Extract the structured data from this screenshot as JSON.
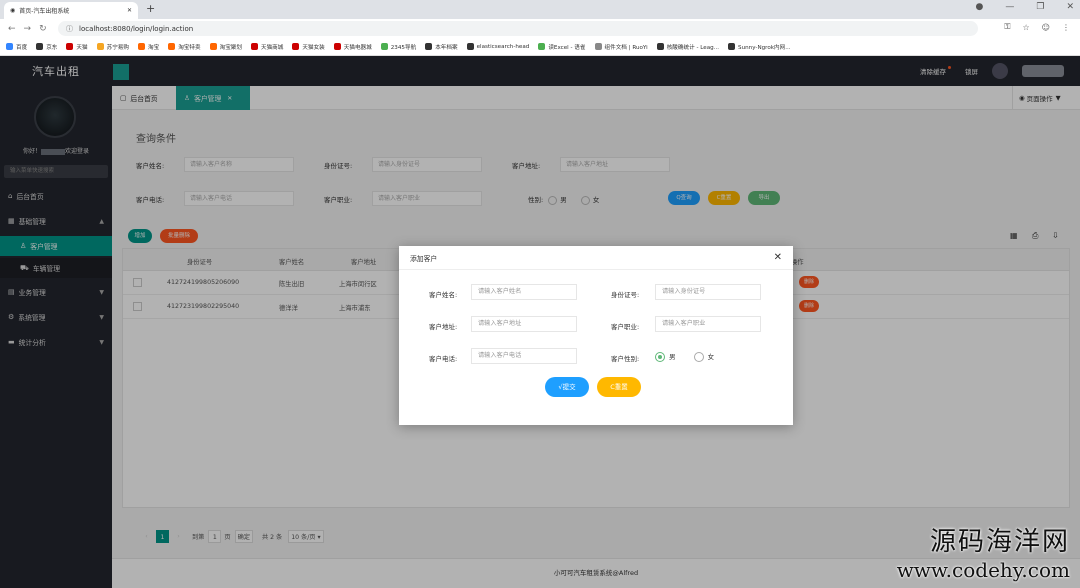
{
  "browser": {
    "tab_title": "首页-汽车出租系统",
    "url": "localhost:8080/login/login.action",
    "bookmarks": [
      {
        "label": "百度",
        "color": "#3385ff"
      },
      {
        "label": "京东",
        "color": "#333"
      },
      {
        "label": "天猫",
        "color": "#c00"
      },
      {
        "label": "苏宁易购",
        "color": "#f5a623"
      },
      {
        "label": "淘宝",
        "color": "#ff6600"
      },
      {
        "label": "淘宝特卖",
        "color": "#ff6600"
      },
      {
        "label": "淘宝聚划",
        "color": "#ff6600"
      },
      {
        "label": "天猫商城",
        "color": "#c00"
      },
      {
        "label": "天猫女装",
        "color": "#c00"
      },
      {
        "label": "天猫电器城",
        "color": "#c00"
      },
      {
        "label": "2345导航",
        "color": "#4caf50"
      },
      {
        "label": "本年档案",
        "color": "#333"
      },
      {
        "label": "elasticsearch-head",
        "color": "#333"
      },
      {
        "label": "读Excel - 语雀",
        "color": "#4caf50"
      },
      {
        "label": "组件文档 | RuoYi",
        "color": "#888"
      },
      {
        "label": "核酸确统计 - Leag...",
        "color": "#333"
      },
      {
        "label": "Sunny-Ngrok内网...",
        "color": "#333"
      }
    ]
  },
  "app": {
    "logo": "汽车出租",
    "clear_cache": "清除缓存",
    "lock_screen": "锁屏"
  },
  "sidebar": {
    "greeting_prefix": "你好！",
    "greeting_suffix": "欢迎登录",
    "search_placeholder": "输入菜单快速搜索",
    "items": [
      {
        "icon": "⌂",
        "label": "后台首页"
      },
      {
        "icon": "▦",
        "label": "基础管理",
        "caret": "▲"
      },
      {
        "icon": "♙",
        "label": "客户管理"
      },
      {
        "icon": "⛟",
        "label": "车辆管理"
      },
      {
        "icon": "▤",
        "label": "业务管理",
        "caret": "▼"
      },
      {
        "icon": "⚙",
        "label": "系统管理",
        "caret": "▼"
      },
      {
        "icon": "▬",
        "label": "统计分析",
        "caret": "▼"
      }
    ]
  },
  "tabs": {
    "home": "后台首页",
    "customer": "客户管理",
    "page_ops": "页面操作"
  },
  "query": {
    "title": "查询条件",
    "fields": [
      {
        "label": "客户姓名:",
        "placeholder": "请输入客户名称"
      },
      {
        "label": "身份证号:",
        "placeholder": "请输入身份证号"
      },
      {
        "label": "客户地址:",
        "placeholder": "请输入客户地址"
      },
      {
        "label": "客户电话:",
        "placeholder": "请输入客户电话"
      },
      {
        "label": "客户职业:",
        "placeholder": "请输入客户职业"
      }
    ],
    "gender_label": "性别:",
    "gender_male": "男",
    "gender_female": "女",
    "btn_search": "Q查询",
    "btn_reset": "C重置",
    "btn_export": "导出"
  },
  "table": {
    "btn_add": "增加",
    "btn_batch_delete": "批量删除",
    "headers": [
      "身份证号",
      "客户姓名",
      "客户地址",
      "操作"
    ],
    "rows": [
      {
        "id": "412724199805206090",
        "name": "陈生出旧",
        "addr": "上海市闵行区",
        "op": "删除"
      },
      {
        "id": "412723199802295040",
        "name": "德洋洋",
        "addr": "上海市浦东",
        "op": "删除"
      }
    ]
  },
  "pagination": {
    "current": "1",
    "goto_label": "到第",
    "goto_value": "1",
    "page_unit": "页",
    "confirm": "确定",
    "total": "共 2 条",
    "per_page": "10 条/页"
  },
  "footer": "小可可汽车租赁系统@Alfred",
  "modal": {
    "title": "添加客户",
    "fields": [
      {
        "label": "客户姓名:",
        "placeholder": "请输入客户姓名"
      },
      {
        "label": "身份证号:",
        "placeholder": "请输入身份证号"
      },
      {
        "label": "客户地址:",
        "placeholder": "请输入客户地址"
      },
      {
        "label": "客户职业:",
        "placeholder": "请输入客户职业"
      },
      {
        "label": "客户电话:",
        "placeholder": "请输入客户电话"
      }
    ],
    "gender_label": "客户性别:",
    "gender_male": "男",
    "gender_female": "女",
    "gender_selected": "男",
    "btn_submit": "√提交",
    "btn_reset": "C重置"
  },
  "watermark": {
    "line1": "源码海洋网",
    "line2": "www.codehy.com"
  },
  "colors": {
    "dark": "#23262e",
    "teal": "#009688",
    "blue": "#1e9fff",
    "orange": "#ffb800",
    "red": "#ff5722",
    "green": "#5fb878"
  }
}
